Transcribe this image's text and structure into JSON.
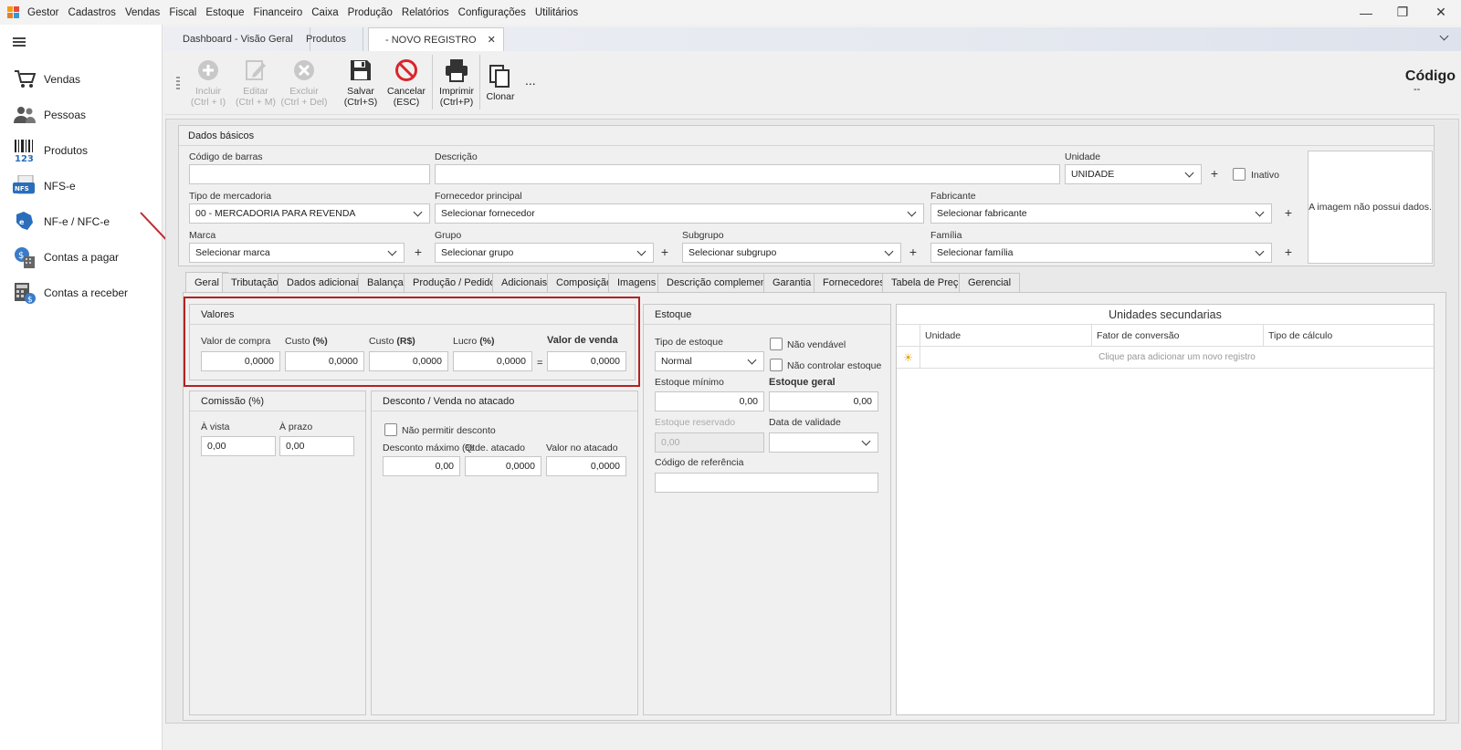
{
  "menu": {
    "items": [
      "Gestor",
      "Cadastros",
      "Vendas",
      "Fiscal",
      "Estoque",
      "Financeiro",
      "Caixa",
      "Produção",
      "Relatórios",
      "Configurações",
      "Utilitários"
    ]
  },
  "window_controls": {
    "minimize": "—",
    "restore": "❐",
    "close": "✕"
  },
  "sidebar": {
    "items": [
      {
        "label": "Vendas",
        "icon": "cart-icon"
      },
      {
        "label": "Pessoas",
        "icon": "people-icon"
      },
      {
        "label": "Produtos",
        "icon": "barcode-icon"
      },
      {
        "label": "NFS-e",
        "icon": "nfse-icon"
      },
      {
        "label": "NF-e / NFC-e",
        "icon": "nfe-icon"
      },
      {
        "label": "Contas a pagar",
        "icon": "bills-icon"
      },
      {
        "label": "Contas a receber",
        "icon": "receivable-icon"
      }
    ]
  },
  "doc_tabs": [
    {
      "label": "Dashboard - Visão Geral"
    },
    {
      "label": "Produtos"
    },
    {
      "label": "- NOVO REGISTRO",
      "close": "✕"
    }
  ],
  "toolbar": {
    "incluir": {
      "label": "Incluir",
      "shortcut": "(Ctrl + I)"
    },
    "editar": {
      "label": "Editar",
      "shortcut": "(Ctrl + M)"
    },
    "excluir": {
      "label": "Excluir",
      "shortcut": "(Ctrl + Del)"
    },
    "salvar": {
      "label": "Salvar",
      "shortcut": "(Ctrl+S)"
    },
    "cancelar": {
      "label": "Cancelar",
      "shortcut": "(ESC)"
    },
    "imprimir": {
      "label": "Imprimir",
      "shortcut": "(Ctrl+P)"
    },
    "clonar": {
      "label": "Clonar"
    },
    "more": "...",
    "codigo_label": "Código",
    "codigo_value": "--"
  },
  "dados_basicos": {
    "title": "Dados básicos",
    "codigo_barras": {
      "label": "Código de barras",
      "value": ""
    },
    "descricao": {
      "label": "Descrição",
      "value": ""
    },
    "unidade": {
      "label": "Unidade",
      "value": "UNIDADE"
    },
    "inativo": {
      "label": "Inativo"
    },
    "tipo_mercadoria": {
      "label": "Tipo de mercadoria",
      "value": "00 - MERCADORIA PARA REVENDA"
    },
    "fornecedor": {
      "label": "Fornecedor principal",
      "value": "Selecionar fornecedor"
    },
    "fabricante": {
      "label": "Fabricante",
      "value": "Selecionar fabricante"
    },
    "marca": {
      "label": "Marca",
      "value": "Selecionar marca"
    },
    "grupo": {
      "label": "Grupo",
      "value": "Selecionar grupo"
    },
    "subgrupo": {
      "label": "Subgrupo",
      "value": "Selecionar subgrupo"
    },
    "familia": {
      "label": "Família",
      "value": "Selecionar família"
    },
    "imagem_msg": "A imagem não possui dados."
  },
  "page_tabs": [
    "Geral",
    "Tributação",
    "Dados adicionais",
    "Balança",
    "Produção / Pedidos",
    "Adicionais",
    "Composição",
    "Imagens",
    "Descrição complementar",
    "Garantia",
    "Fornecedores",
    "Tabela de Preço",
    "Gerencial"
  ],
  "valores": {
    "title": "Valores",
    "valor_compra": {
      "label": "Valor de compra",
      "value": "0,0000"
    },
    "custo_pct": {
      "label": "Custo",
      "unit": "(%)",
      "value": "0,0000"
    },
    "custo_rs": {
      "label": "Custo",
      "unit": "(R$)",
      "value": "0,0000"
    },
    "lucro": {
      "label": "Lucro",
      "unit": "(%)",
      "value": "0,0000"
    },
    "equals": "=",
    "valor_venda": {
      "label": "Valor de venda",
      "value": "0,0000"
    }
  },
  "comissao": {
    "title": "Comissão (%)",
    "a_vista": {
      "label": "À vista",
      "value": "0,00"
    },
    "a_prazo": {
      "label": "À prazo",
      "value": "0,00"
    }
  },
  "desconto": {
    "title": "Desconto / Venda no atacado",
    "nao_permitir": "Não permitir desconto",
    "desconto_max": {
      "label": "Desconto máximo (%",
      "value": "0,00"
    },
    "qtde_atacado": {
      "label": "Qtde. atacado",
      "value": "0,0000"
    },
    "valor_atacado": {
      "label": "Valor no atacado",
      "value": "0,0000"
    }
  },
  "estoque": {
    "title": "Estoque",
    "tipo": {
      "label": "Tipo de estoque",
      "value": "Normal"
    },
    "nao_vendavel": "Não vendável",
    "nao_controlar": "Não controlar estoque",
    "minimo": {
      "label": "Estoque mínimo",
      "value": "0,00"
    },
    "geral": {
      "label": "Estoque geral",
      "value": "0,00"
    },
    "reservado": {
      "label": "Estoque reservado",
      "value": "0,00"
    },
    "validade": {
      "label": "Data de validade",
      "value": ""
    },
    "codigo_ref": {
      "label": "Código de referência",
      "value": ""
    }
  },
  "unidades_sec": {
    "title": "Unidades secundarias",
    "columns": [
      "Unidade",
      "Fator de conversão",
      "Tipo de cálculo"
    ],
    "new_row_hint": "Clique para adicionar um novo registro"
  },
  "colors": {
    "accent": "#b22222",
    "save_icon": "#333333",
    "cancel_icon": "#d9262b"
  }
}
